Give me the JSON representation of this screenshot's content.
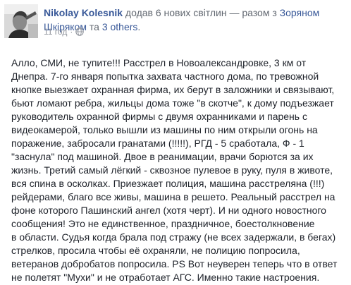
{
  "post": {
    "author": "Nikolay Kolesnik",
    "action_prefix": " додав 6 нових світлин — разом з ",
    "tagged_person": "Зоряном Шкіряком",
    "conjunction": " та ",
    "others": "3 others",
    "end_punct": ".",
    "time": "11 год",
    "dot": "·",
    "privacy_icon": "globe-icon"
  },
  "body_lines": [
    "Алло, СМИ, не тупите!!! Расстрел в Новоалександровке, 3 км от",
    "Днепра. 7-го января попытка захвата частного дома, по тревожной",
    "кнопке выезжает охранная фирма, их берут в заложники и связывают,",
    "бьют ломают ребра, жильцы дома тоже \"в скотче\", к дому подъезжает",
    "руководитель охранной фирмы с двумя охранниками и парень с",
    "видеокамерой, только вышли из машины по ним открыли огонь на",
    "поражение, забросали гранатами (!!!!!), РГД - 5 сработала, Ф - 1",
    "\"заснула\" под машиной. Двое в реанимации, врачи борются за их",
    "жизнь. Третий самый лёгкий - сквозное пулевое в руку, пуля в животе,",
    "вся спина в осколках. Приезжает полиция, машина расстреляна (!!!)",
    "рейдерами, благо все живы, машина в решето. Реальный расстрел на",
    "фоне которого Пашинский ангел (хотя черт). И ни одного новостного",
    "сообщения! Это не единственное, праздничное, боестолкновение",
    "в области. Судья когда брала под стражу (не всех задержали, в бегах)",
    "стрелков, просила чтобы её охраняли, не полицию попросила,",
    "ветеранов добробатов попросила. PS Вот неуверен теперь что в ответ",
    "не полетят \"Мухи\" и не отработает АГС. Именно такие настроения."
  ]
}
